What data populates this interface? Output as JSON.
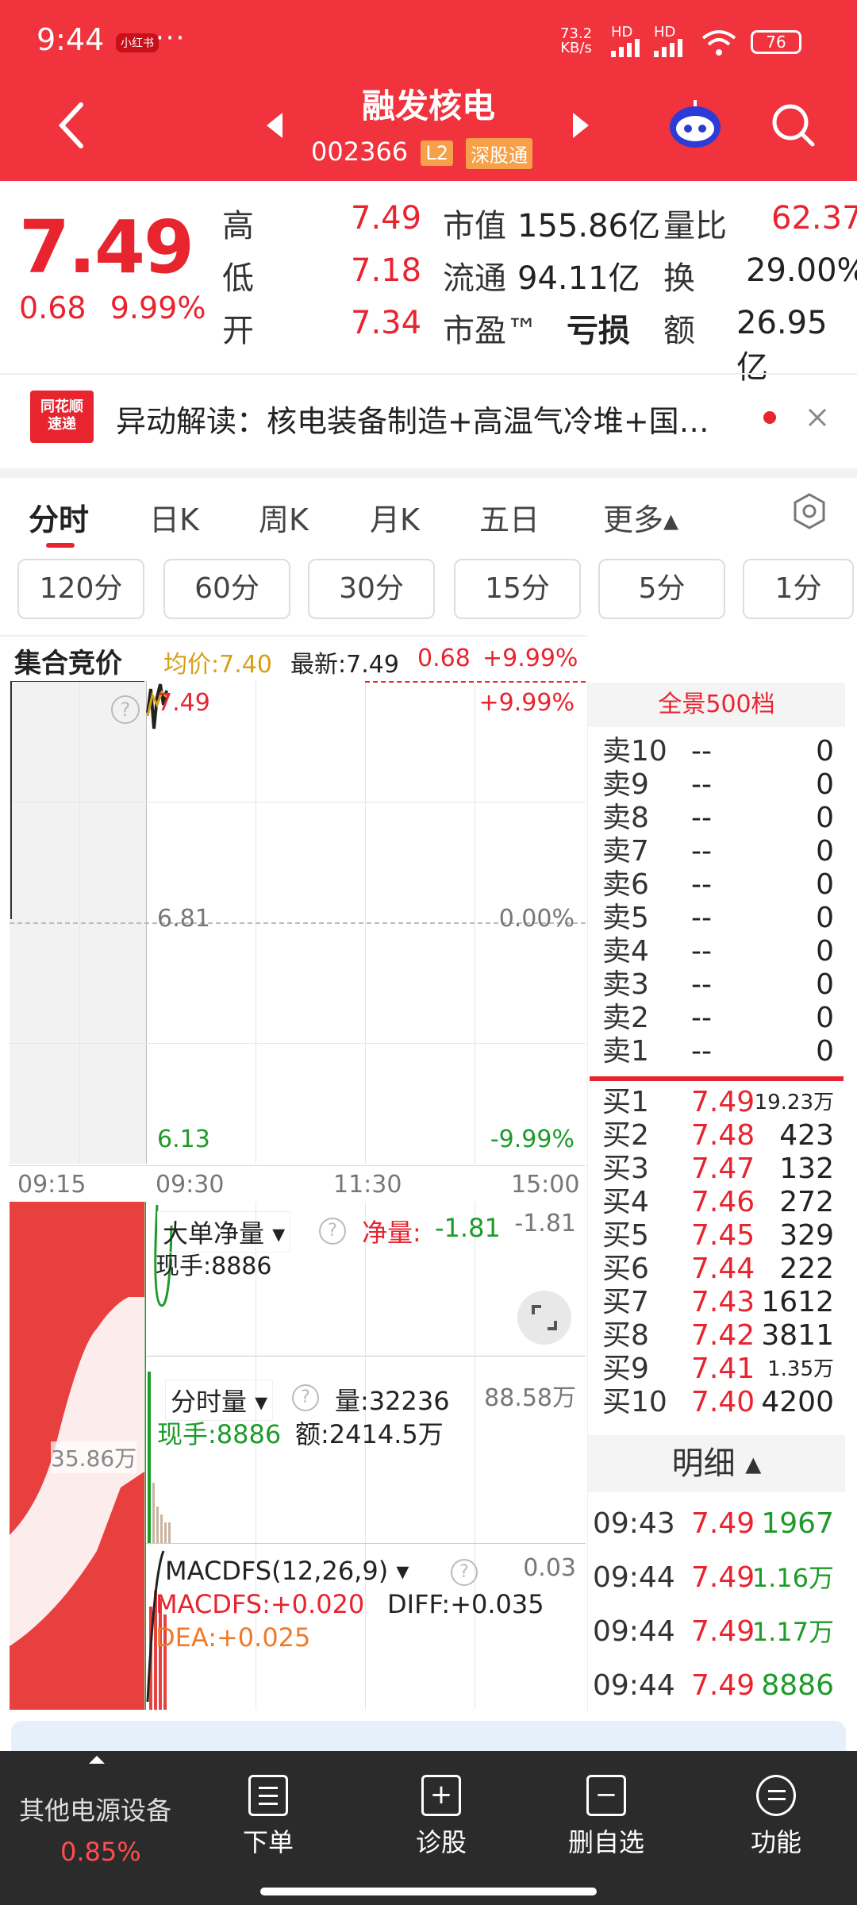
{
  "status_bar": {
    "time": "9:44",
    "badge": "小红书",
    "dots": "···",
    "net_speed": "73.2",
    "net_unit": "KB/s",
    "signal1": "HD",
    "signal2": "HD",
    "battery": "76"
  },
  "header": {
    "title": "融发核电",
    "code": "002366",
    "tag_level": "L2",
    "tag_connect": "深股通"
  },
  "quote": {
    "price": "7.49",
    "change": "0.68",
    "change_pct": "9.99%",
    "high_label": "高",
    "high": "7.49",
    "low_label": "低",
    "low": "7.18",
    "open_label": "开",
    "open": "7.34",
    "mktcap_label": "市值",
    "mktcap": "155.86亿",
    "float_label": "流通",
    "float": "94.11亿",
    "pe_label": "市盈™",
    "pe": "亏损",
    "vol_ratio_label": "量比",
    "vol_ratio": "62.37",
    "turnover_label": "换",
    "turnover": "29.00%",
    "amount_label": "额",
    "amount": "26.95亿"
  },
  "news": {
    "logo_line1": "同花顺",
    "logo_line2": "速递",
    "text": "异动解读：核电装备制造+高温气冷堆+国…"
  },
  "tabs": [
    "分时",
    "日K",
    "周K",
    "月K",
    "五日",
    "更多▴"
  ],
  "periods": [
    "120分",
    "60分",
    "30分",
    "15分",
    "5分",
    "1分"
  ],
  "auction": {
    "label": "集合竞价",
    "avg": "均价:7.40",
    "latest": "最新:7.49",
    "change": "0.68",
    "pct": "+9.99%"
  },
  "chart_main": {
    "top_price": "7.49",
    "mid_price": "6.81",
    "low_price": "6.13",
    "top_pct": "+9.99%",
    "mid_pct": "0.00%",
    "low_pct": "-9.99%",
    "times": [
      "09:15",
      "09:30",
      "11:30",
      "15:00"
    ],
    "help": "?"
  },
  "panel_bigorder": {
    "title": "大单净量 ▾",
    "net_label": "净量:",
    "net_value": "-1.81",
    "right_value": "-1.81",
    "current": "现手:8886"
  },
  "panel_volume": {
    "title": "分时量 ▾",
    "vol": "量:32236",
    "current": "现手:8886",
    "amount": "额:2414.5万",
    "right_value": "88.58万",
    "left_value": "35.86万"
  },
  "panel_macd": {
    "title": "MACDFS(12,26,9) ▾",
    "macd": "MACDFS:+0.020",
    "diff": "DIFF:+0.035",
    "dea": "DEA:+0.025",
    "right_value": "0.03"
  },
  "book": {
    "header": "全景500档",
    "sells": [
      {
        "label": "卖10",
        "price": "--",
        "vol": "0"
      },
      {
        "label": "卖9",
        "price": "--",
        "vol": "0"
      },
      {
        "label": "卖8",
        "price": "--",
        "vol": "0"
      },
      {
        "label": "卖7",
        "price": "--",
        "vol": "0"
      },
      {
        "label": "卖6",
        "price": "--",
        "vol": "0"
      },
      {
        "label": "卖5",
        "price": "--",
        "vol": "0"
      },
      {
        "label": "卖4",
        "price": "--",
        "vol": "0"
      },
      {
        "label": "卖3",
        "price": "--",
        "vol": "0"
      },
      {
        "label": "卖2",
        "price": "--",
        "vol": "0"
      },
      {
        "label": "卖1",
        "price": "--",
        "vol": "0"
      }
    ],
    "buys": [
      {
        "label": "买1",
        "price": "7.49",
        "vol": "19.23万"
      },
      {
        "label": "买2",
        "price": "7.48",
        "vol": "423"
      },
      {
        "label": "买3",
        "price": "7.47",
        "vol": "132"
      },
      {
        "label": "买4",
        "price": "7.46",
        "vol": "272"
      },
      {
        "label": "买5",
        "price": "7.45",
        "vol": "329"
      },
      {
        "label": "买6",
        "price": "7.44",
        "vol": "222"
      },
      {
        "label": "买7",
        "price": "7.43",
        "vol": "1612"
      },
      {
        "label": "买8",
        "price": "7.42",
        "vol": "3811"
      },
      {
        "label": "买9",
        "price": "7.41",
        "vol": "1.35万"
      },
      {
        "label": "买10",
        "price": "7.40",
        "vol": "4200"
      }
    ],
    "detail_header": "明细 ▴",
    "details": [
      {
        "time": "09:43",
        "price": "7.49",
        "vol": "1967"
      },
      {
        "time": "09:44",
        "price": "7.49",
        "vol": "1.16万"
      },
      {
        "time": "09:44",
        "price": "7.49",
        "vol": "1.17万"
      },
      {
        "time": "09:44",
        "price": "7.49",
        "vol": "8886"
      }
    ]
  },
  "bottom": {
    "sector": "其他电源设备",
    "sector_pct": "0.85%",
    "items": [
      "下单",
      "诊股",
      "删自选",
      "功能"
    ]
  },
  "colors": {
    "brand": "#f0333d",
    "up": "#e8242f",
    "down": "#1d9b2a",
    "accent": "#d4a017"
  }
}
